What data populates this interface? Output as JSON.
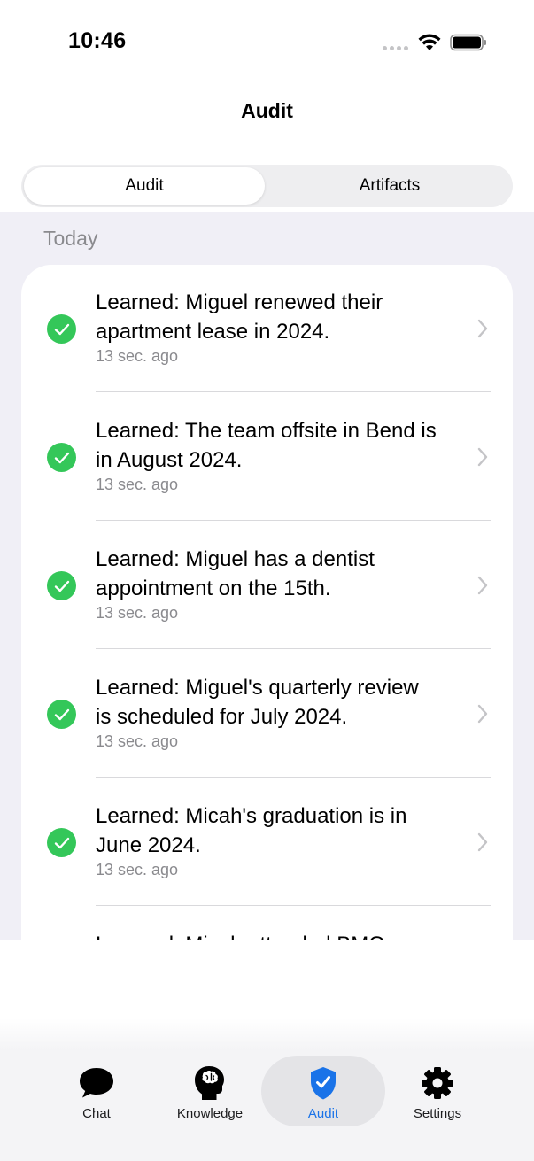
{
  "status_bar": {
    "time": "10:46"
  },
  "nav": {
    "title": "Audit"
  },
  "segments": [
    {
      "label": "Audit",
      "selected": true
    },
    {
      "label": "Artifacts",
      "selected": false
    }
  ],
  "section": {
    "header": "Today"
  },
  "rows": [
    {
      "title_line1": "Learned: Miguel renewed their",
      "title_line2": "apartment lease in 2024.",
      "time": "13 sec. ago"
    },
    {
      "title_line1": "Learned: The team offsite in Bend is",
      "title_line2": "in August 2024.",
      "time": "13 sec. ago"
    },
    {
      "title_line1": "Learned: Miguel has a dentist",
      "title_line2": "appointment on the 15th.",
      "time": "13 sec. ago"
    },
    {
      "title_line1": "Learned: Miguel's quarterly review",
      "title_line2": "is scheduled for July 2024.",
      "time": "13 sec. ago"
    },
    {
      "title_line1": "Learned: Micah's graduation is in",
      "title_line2": "June 2024.",
      "time": "13 sec. ago"
    },
    {
      "title_line1": "Learned: Micah attended BMO...",
      "title_line2": "",
      "time": ""
    }
  ],
  "tabs": [
    {
      "label": "Chat",
      "icon": "chat-bubble-icon",
      "active": false
    },
    {
      "label": "Knowledge",
      "icon": "brain-head-icon",
      "active": false
    },
    {
      "label": "Audit",
      "icon": "shield-check-icon",
      "active": true
    },
    {
      "label": "Settings",
      "icon": "gear-icon",
      "active": false
    }
  ],
  "colors": {
    "accent": "#1a73e8",
    "success": "#34c759",
    "grouped_background": "#f0eff6",
    "secondary_text": "#8a8a8e"
  }
}
